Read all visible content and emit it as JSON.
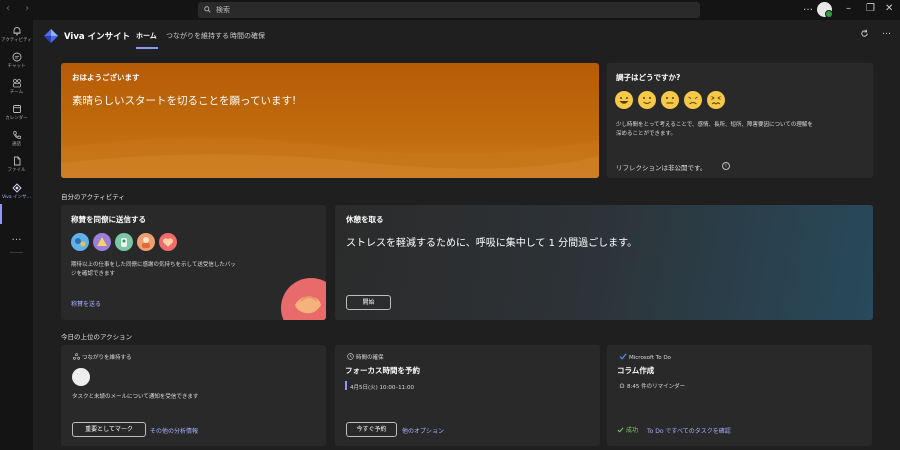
{
  "titlebar": {
    "search_placeholder": "検索",
    "more": "…",
    "minimize": "–",
    "restore": "❐",
    "close": "✕"
  },
  "rail": {
    "items": [
      {
        "label": "アクティビティ",
        "icon": "bell-icon"
      },
      {
        "label": "チャット",
        "icon": "chat-icon"
      },
      {
        "label": "チーム",
        "icon": "teams-icon"
      },
      {
        "label": "カレンダー",
        "icon": "calendar-icon"
      },
      {
        "label": "通話",
        "icon": "phone-icon"
      },
      {
        "label": "ファイル",
        "icon": "file-icon"
      },
      {
        "label": "Viva インサ…",
        "icon": "viva-insights-icon"
      }
    ],
    "more": "…"
  },
  "header": {
    "app_title": "Viva インサイト",
    "tabs": [
      "ホーム",
      "つながりを維持する",
      "時間の確保"
    ],
    "more": "…"
  },
  "hero": {
    "greeting": "おはようございます",
    "message": "素晴らしいスタートを切ることを願っています!"
  },
  "mood": {
    "title": "調子はどうですか?",
    "faces": [
      "very-happy-face-icon",
      "happy-face-icon",
      "neutral-face-icon",
      "sad-face-icon",
      "very-sad-face-icon"
    ],
    "description": "少し時間をとって考えることで、感情、長所、短所、障害要因についての理解を深めることができます。",
    "private_note": "リフレクションは非公開です。",
    "info": "i"
  },
  "activity_section": "自分のアクティビティ",
  "praise": {
    "title": "称賛を同僚に送信する",
    "description": "期待以上の仕事をした同僚に感謝の気持ちを示して送受信したバッジを確認できます",
    "link": "称賛を送る"
  },
  "breath": {
    "title": "休憩を取る",
    "message": "ストレスを軽減するために、呼吸に集中して 1 分間過ごします。",
    "button": "開始"
  },
  "actions_section": "今日の上位のアクション",
  "actions": [
    {
      "category": "つながりを維持する",
      "description": "タスクと未読のメールについて通知を受信できます",
      "button": "重要としてマーク",
      "link": "その他の分析情報"
    },
    {
      "category": "時間の確保",
      "title": "フォーカス時間を予約",
      "time": "4月5日(火) 10:00–11:00",
      "button": "今すぐ予約",
      "link": "他のオプション"
    },
    {
      "category": "Microsoft To Do",
      "title": "コラム作成",
      "reminder": "8:45 件のリマインダー",
      "status": "成功",
      "link": "To Do ですべてのタスクを確認"
    }
  ],
  "colors": {
    "accent": "#8f96ff",
    "hero": "#b65b06",
    "face": "#f7c948",
    "success": "#7bc86c"
  }
}
